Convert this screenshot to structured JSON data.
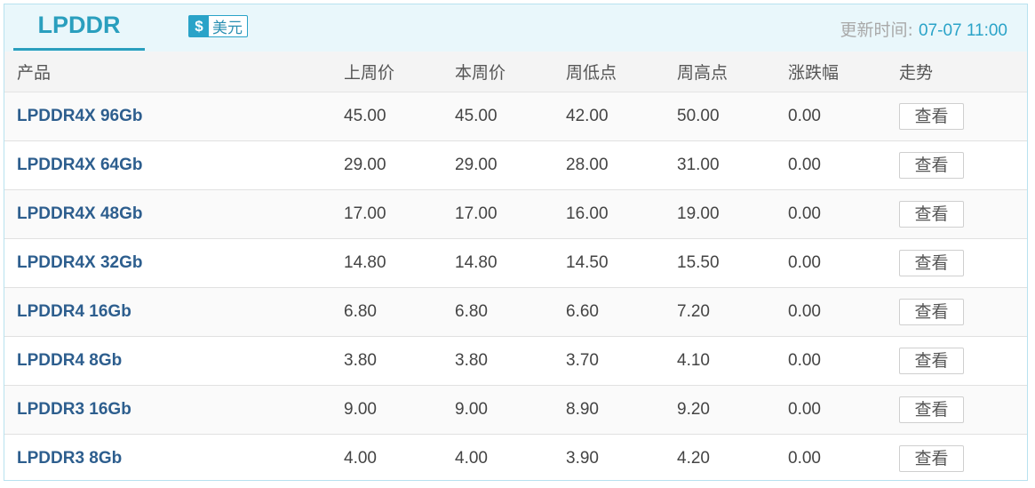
{
  "header": {
    "tab_title": "LPDDR",
    "currency_symbol": "$",
    "currency_label": "美元",
    "update_label": "更新时间: ",
    "update_time": "07-07 11:00"
  },
  "table": {
    "columns": [
      "产品",
      "上周价",
      "本周价",
      "周低点",
      "周高点",
      "涨跌幅",
      "走势"
    ],
    "rows": [
      {
        "product": "LPDDR4X 96Gb",
        "last_week": "45.00",
        "this_week": "45.00",
        "weekly_low": "42.00",
        "weekly_high": "50.00",
        "change": "0.00",
        "trend_button": "查看"
      },
      {
        "product": "LPDDR4X 64Gb",
        "last_week": "29.00",
        "this_week": "29.00",
        "weekly_low": "28.00",
        "weekly_high": "31.00",
        "change": "0.00",
        "trend_button": "查看"
      },
      {
        "product": "LPDDR4X 48Gb",
        "last_week": "17.00",
        "this_week": "17.00",
        "weekly_low": "16.00",
        "weekly_high": "19.00",
        "change": "0.00",
        "trend_button": "查看"
      },
      {
        "product": "LPDDR4X 32Gb",
        "last_week": "14.80",
        "this_week": "14.80",
        "weekly_low": "14.50",
        "weekly_high": "15.50",
        "change": "0.00",
        "trend_button": "查看"
      },
      {
        "product": "LPDDR4 16Gb",
        "last_week": "6.80",
        "this_week": "6.80",
        "weekly_low": "6.60",
        "weekly_high": "7.20",
        "change": "0.00",
        "trend_button": "查看"
      },
      {
        "product": "LPDDR4 8Gb",
        "last_week": "3.80",
        "this_week": "3.80",
        "weekly_low": "3.70",
        "weekly_high": "4.10",
        "change": "0.00",
        "trend_button": "查看"
      },
      {
        "product": "LPDDR3 16Gb",
        "last_week": "9.00",
        "this_week": "9.00",
        "weekly_low": "8.90",
        "weekly_high": "9.20",
        "change": "0.00",
        "trend_button": "查看"
      },
      {
        "product": "LPDDR3 8Gb",
        "last_week": "4.00",
        "this_week": "4.00",
        "weekly_low": "3.90",
        "weekly_high": "4.20",
        "change": "0.00",
        "trend_button": "查看"
      }
    ]
  },
  "colors": {
    "accent": "#2aa3c8",
    "product_name": "#2d5e8e",
    "header_bg": "#e9f7fb",
    "muted_text": "#a9a9a9"
  }
}
